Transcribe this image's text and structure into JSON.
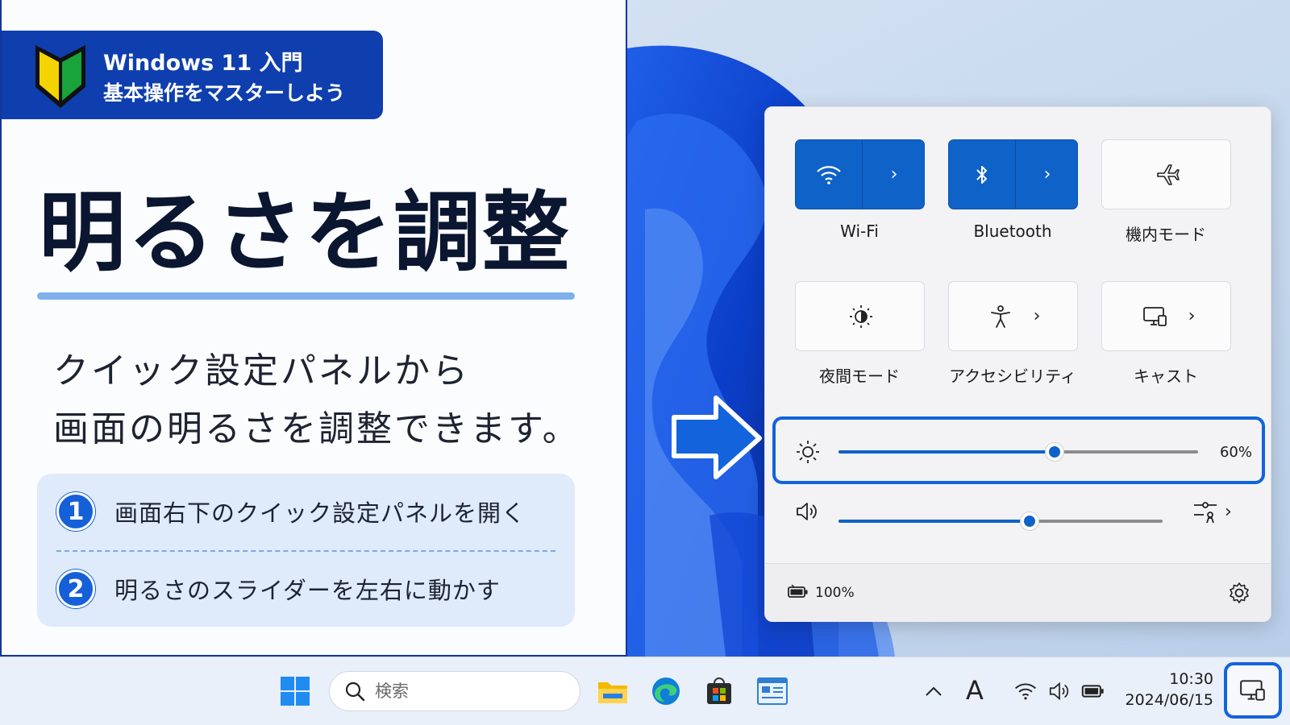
{
  "banner": {
    "line1": "Windows 11 入門",
    "line2": "基本操作をマスターしよう"
  },
  "headline": "明るさを調整",
  "subtext": {
    "line1": "クイック設定パネルから",
    "line2": "画面の明るさを調整できます。"
  },
  "steps": [
    {
      "number": "1",
      "text": "画面右下のクイック設定パネルを開く"
    },
    {
      "number": "2",
      "text": "明るさのスライダーを左右に動かす"
    }
  ],
  "quick_settings": {
    "tiles": [
      {
        "label": "Wi-Fi",
        "icon": "wifi-icon",
        "state": "on",
        "expandable": true
      },
      {
        "label": "Bluetooth",
        "icon": "bluetooth-icon",
        "state": "on",
        "expandable": true
      },
      {
        "label": "機内モード",
        "icon": "airplane-icon",
        "state": "off",
        "expandable": false
      },
      {
        "label": "夜間モード",
        "icon": "night-light-icon",
        "state": "off",
        "expandable": false
      },
      {
        "label": "アクセシビリティ",
        "icon": "accessibility-icon",
        "state": "off",
        "expandable": true
      },
      {
        "label": "キャスト",
        "icon": "cast-icon",
        "state": "off",
        "expandable": true
      }
    ],
    "brightness": {
      "value_text": "60%",
      "level": 0.6
    },
    "volume": {
      "level": 0.59
    },
    "battery": {
      "value_text": "100%"
    }
  },
  "taskbar": {
    "search_placeholder": "検索",
    "clock": {
      "time": "10:30",
      "date": "2024/06/15"
    },
    "ime_indicator": "A"
  },
  "colors": {
    "accent": "#0f62c8",
    "banner": "#0f3fae",
    "highlight": "#1363dc"
  }
}
